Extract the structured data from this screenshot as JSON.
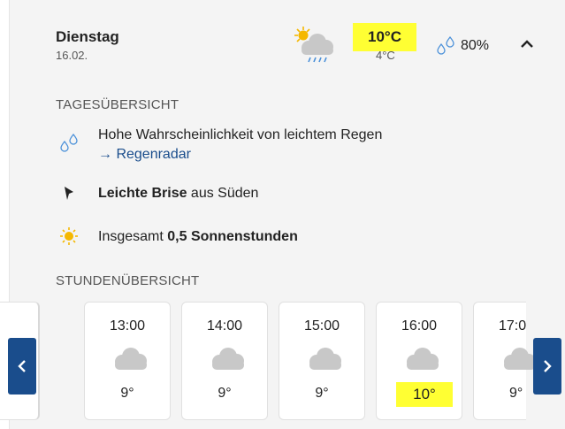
{
  "header": {
    "day_name": "Dienstag",
    "date": "16.02.",
    "icon": "partly-sunny-rain-icon",
    "temp_max": "10°C",
    "temp_min": "4°C",
    "rain_probability": "80%",
    "collapse_icon": "chevron-up-icon"
  },
  "overview": {
    "title": "TAGESÜBERSICHT",
    "rain_text": "Hohe Wahrscheinlichkeit von leichtem Regen",
    "rain_link": "→ Regenradar",
    "wind_bold": "Leichte Brise",
    "wind_rest": " aus Süden",
    "sun_prefix": "Insgesamt ",
    "sun_bold": "0,5 Sonnenstunden"
  },
  "hourly": {
    "title": "STUNDENÜBERSICHT",
    "hours": [
      {
        "time": "13:00",
        "temp": "9°",
        "icon": "cloud-icon"
      },
      {
        "time": "14:00",
        "temp": "9°",
        "icon": "cloud-icon"
      },
      {
        "time": "15:00",
        "temp": "9°",
        "icon": "cloud-icon"
      },
      {
        "time": "16:00",
        "temp": "10°",
        "icon": "cloud-icon"
      },
      {
        "time": "17:0",
        "temp": "9°",
        "icon": "cloud-icon"
      }
    ]
  },
  "colors": {
    "highlight": "#ffff33",
    "accent": "#1a4d8c",
    "sun": "#f5b800",
    "rain": "#4a90d9",
    "cloud": "#c8c8c8"
  }
}
